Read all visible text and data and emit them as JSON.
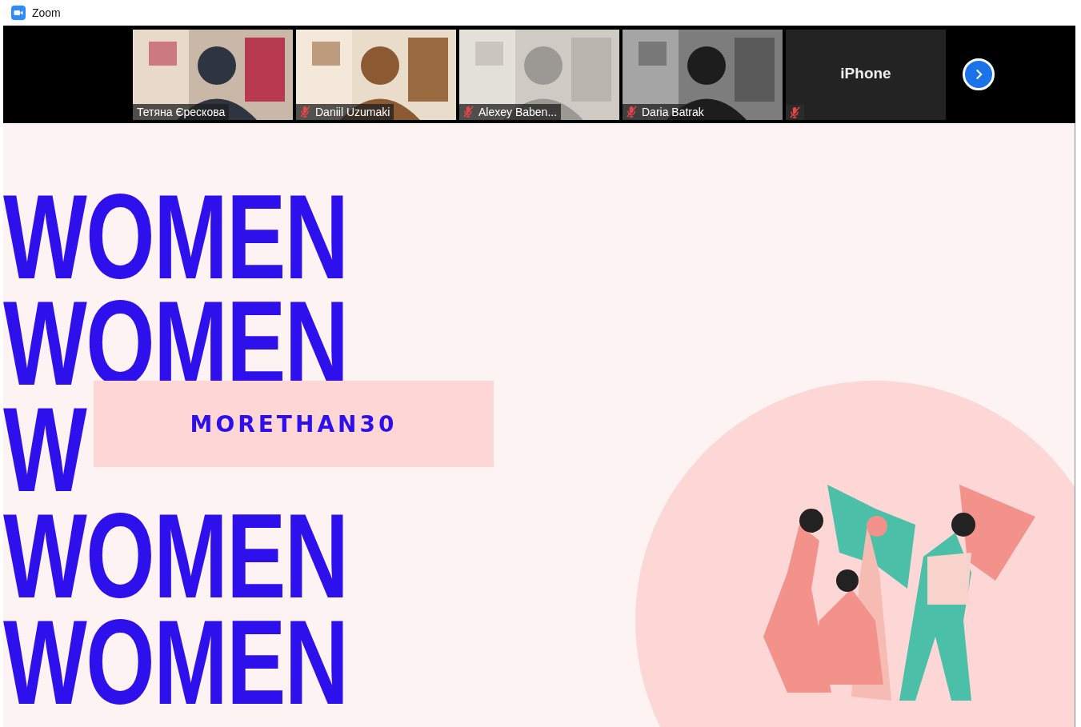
{
  "window": {
    "title": "Zoom"
  },
  "participants": [
    {
      "name": "Тетяна Єрескова",
      "muted": false,
      "kind": "video"
    },
    {
      "name": "Daniil Uzumaki",
      "muted": true,
      "kind": "video"
    },
    {
      "name": "Alexey Baben...",
      "muted": true,
      "kind": "video"
    },
    {
      "name": "Daria Batrak",
      "muted": true,
      "kind": "video"
    },
    {
      "name": "iPhone",
      "muted": true,
      "kind": "name"
    }
  ],
  "slide": {
    "words": [
      "WOMEN",
      "WOMEN",
      "W",
      "WOMEN",
      "WOMEN"
    ],
    "tag": "MORETHAN30"
  }
}
